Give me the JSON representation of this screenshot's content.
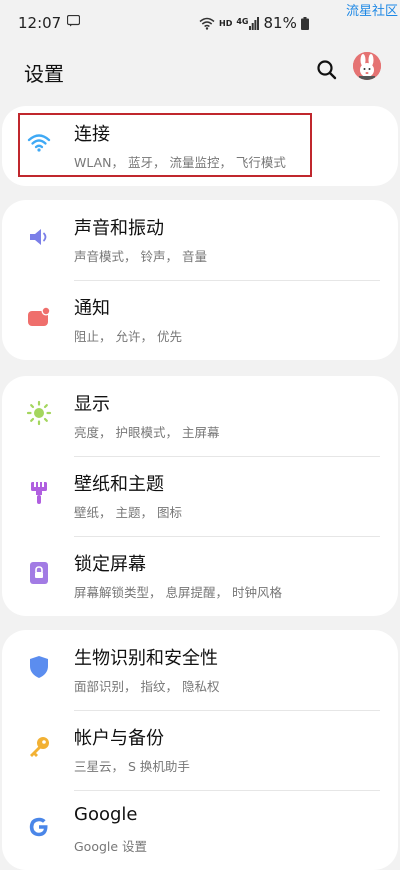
{
  "status_bar": {
    "time": "12:07",
    "network_label": "HD",
    "signal_label": "4G",
    "battery": "81%"
  },
  "watermark": "流星社区",
  "header": {
    "title": "设置"
  },
  "groups": [
    {
      "items": [
        {
          "label": "连接",
          "sub": "WLAN， 蓝牙， 流量监控， 飞行模式",
          "icon": "wifi-icon"
        }
      ]
    },
    {
      "items": [
        {
          "label": "声音和振动",
          "sub": "声音模式， 铃声， 音量",
          "icon": "speaker-icon"
        },
        {
          "label": "通知",
          "sub": "阻止， 允许， 优先",
          "icon": "notification-icon"
        }
      ]
    },
    {
      "items": [
        {
          "label": "显示",
          "sub": "亮度， 护眼模式， 主屏幕",
          "icon": "brightness-icon"
        },
        {
          "label": "壁纸和主题",
          "sub": "壁纸， 主题， 图标",
          "icon": "brush-icon"
        },
        {
          "label": "锁定屏幕",
          "sub": "屏幕解锁类型， 息屏提醒， 时钟风格",
          "icon": "lock-icon"
        }
      ]
    },
    {
      "items": [
        {
          "label": "生物识别和安全性",
          "sub": "面部识别， 指纹， 隐私权",
          "icon": "shield-icon"
        },
        {
          "label": "帐户与备份",
          "sub": "三星云， S 换机助手",
          "icon": "key-icon"
        },
        {
          "label": "Google",
          "sub": "Google 设置",
          "icon": "google-icon"
        }
      ]
    }
  ],
  "colors": {
    "highlight": "#c0272d",
    "wifi": "#3fa9f5",
    "sound": "#7b7fe8",
    "notify": "#ef6f6c",
    "display": "#a4d65e",
    "wallpaper": "#b05fe0",
    "lock": "#a27be4",
    "security": "#5b8def",
    "key": "#f2b134"
  }
}
